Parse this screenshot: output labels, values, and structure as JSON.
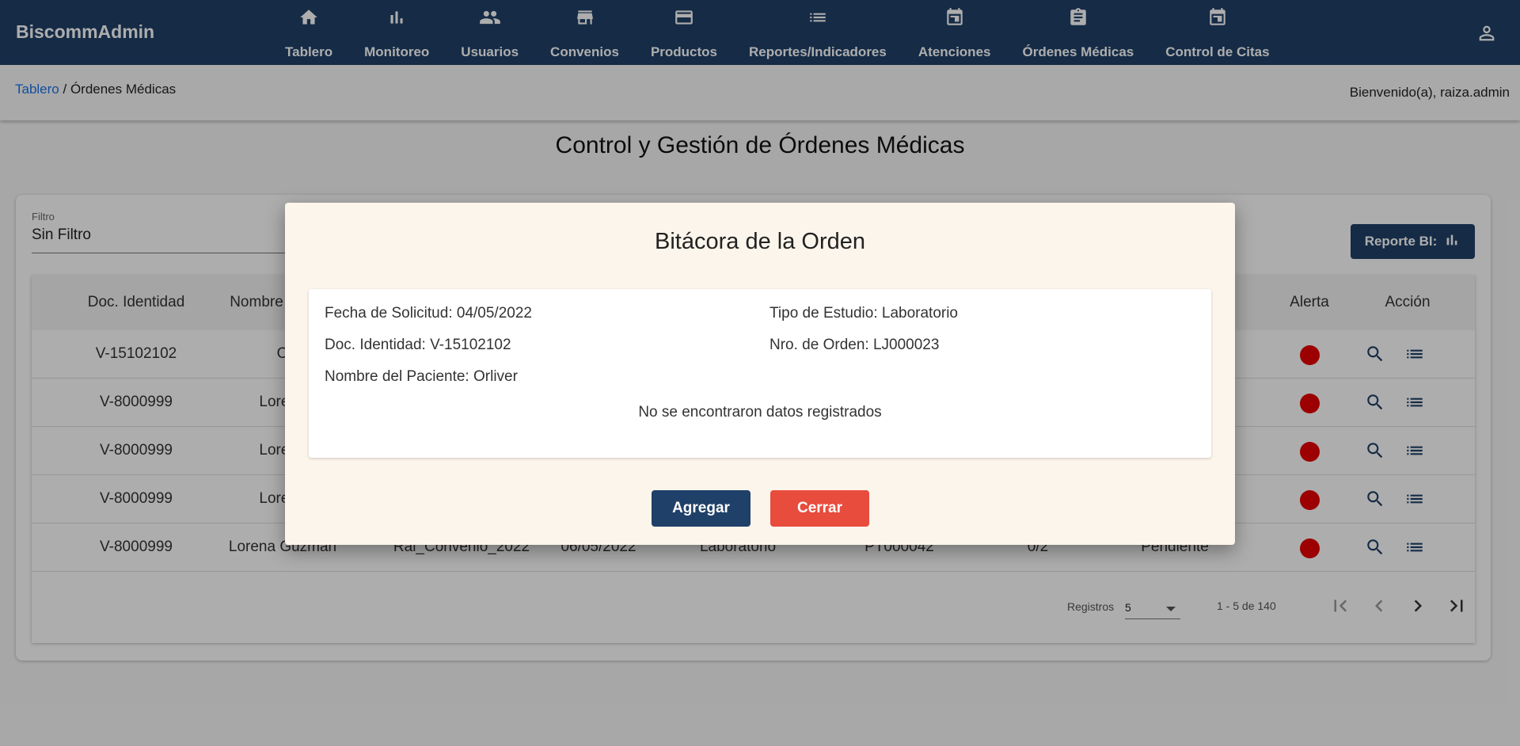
{
  "app": {
    "brand": "BiscommAdmin"
  },
  "nav": [
    {
      "label": "Tablero",
      "icon": "home-icon"
    },
    {
      "label": "Monitoreo",
      "icon": "bar-chart-icon"
    },
    {
      "label": "Usuarios",
      "icon": "people-icon"
    },
    {
      "label": "Convenios",
      "icon": "store-icon"
    },
    {
      "label": "Productos",
      "icon": "credit-card-icon"
    },
    {
      "label": "Reportes/Indicadores",
      "icon": "list-icon"
    },
    {
      "label": "Atenciones",
      "icon": "calendar-icon"
    },
    {
      "label": "Órdenes Médicas",
      "icon": "clipboard-icon"
    },
    {
      "label": "Control de Citas",
      "icon": "calendar-icon"
    }
  ],
  "breadcrumb": {
    "root": "Tablero",
    "sep": " / ",
    "current": "Órdenes Médicas"
  },
  "welcome": "Bienvenido(a), raiza.admin",
  "page_title": "Control y Gestión de Órdenes Médicas",
  "filter": {
    "label": "Filtro",
    "value": "Sin Filtro"
  },
  "report_button": "Reporte BI:",
  "table": {
    "headers": [
      "Doc. Identidad",
      "Nombre",
      "Alerta",
      "Acción"
    ],
    "rows": [
      {
        "doc": "V-15102102",
        "name": "O",
        "convenio": "",
        "fecha": "",
        "tipo": "",
        "orden": "",
        "avance": "",
        "estado": ""
      },
      {
        "doc": "V-8000999",
        "name": "Lorena",
        "convenio": "",
        "fecha": "",
        "tipo": "",
        "orden": "",
        "avance": "",
        "estado": ""
      },
      {
        "doc": "V-8000999",
        "name": "Lorena",
        "convenio": "",
        "fecha": "",
        "tipo": "",
        "orden": "",
        "avance": "",
        "estado": ""
      },
      {
        "doc": "V-8000999",
        "name": "Lorena",
        "convenio": "",
        "fecha": "",
        "tipo": "",
        "orden": "",
        "avance": "",
        "estado": ""
      },
      {
        "doc": "V-8000999",
        "name": "Lorena Guzman",
        "convenio": "Rai_Convenio_2022",
        "fecha": "06/05/2022",
        "tipo": "Laboratorio",
        "orden": "PT000042",
        "avance": "0/2",
        "estado": "Pendiente"
      }
    ],
    "alert_color": "#e60000"
  },
  "pager": {
    "label": "Registros",
    "page_size": "5",
    "range": "1 - 5 de 140"
  },
  "dialog": {
    "title": "Bitácora de la Orden",
    "fecha": "Fecha de Solicitud: 04/05/2022",
    "tipo": "Tipo de Estudio: Laboratorio",
    "doc": "Doc. Identidad: V-15102102",
    "orden": "Nro. de Orden: LJ000023",
    "paciente": "Nombre del Paciente: Orliver",
    "empty": "No se encontraron datos registrados",
    "add_label": "Agregar",
    "close_label": "Cerrar"
  },
  "colors": {
    "primary": "#1f4068",
    "danger": "#e84c3d",
    "dialog_bg": "#fcf5eb"
  }
}
